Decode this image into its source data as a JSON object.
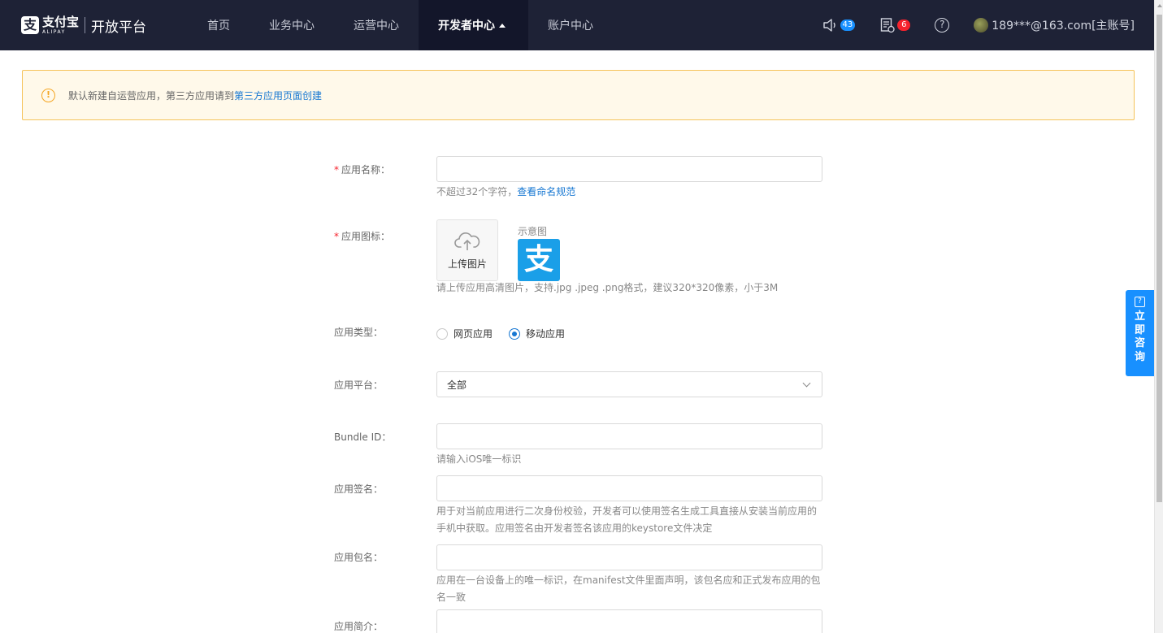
{
  "nav": {
    "brand_cn": "支付宝",
    "brand_en": "ALIPAY",
    "brand_sub": "开放平台",
    "items": [
      {
        "label": "首页"
      },
      {
        "label": "业务中心"
      },
      {
        "label": "运营中心"
      },
      {
        "label": "开发者中心",
        "active": true
      },
      {
        "label": "账户中心"
      }
    ],
    "notifications_count": "43",
    "tasks_count": "6",
    "help_glyph": "?",
    "account": "189***@163.com[主账号]",
    "icons": {
      "speaker": "speaker-icon",
      "task": "task-list-icon",
      "help": "help-icon"
    }
  },
  "alert": {
    "text": "默认新建自运营应用，第三方应用请到",
    "link": "第三方应用页面创建",
    "icon_glyph": "!"
  },
  "form": {
    "app_name": {
      "label": "应用名称：",
      "required": true,
      "value": "",
      "hint_text": "不超过32个字符，",
      "hint_link": "查看命名规范"
    },
    "app_icon": {
      "label": "应用图标：",
      "required": true,
      "upload_label": "上传图片",
      "example_label": "示意图",
      "example_glyph": "支",
      "hint": "请上传应用高清图片，支持.jpg .jpeg .png格式，建议320*320像素，小于3M"
    },
    "app_type": {
      "label": "应用类型：",
      "options": [
        {
          "label": "网页应用",
          "checked": false
        },
        {
          "label": "移动应用",
          "checked": true
        }
      ]
    },
    "platform": {
      "label": "应用平台：",
      "selected": "全部"
    },
    "bundle_id": {
      "label": "Bundle ID：",
      "value": "",
      "hint": "请输入iOS唯一标识"
    },
    "signature": {
      "label": "应用签名：",
      "value": "",
      "hint_line1": "用于对当前应用进行二次身份校验，开发者可以使用签名生成工具直接从安装当前应用的",
      "hint_line2": "手机中获取。应用签名由开发者签名该应用的keystore文件决定"
    },
    "package_name": {
      "label": "应用包名：",
      "value": "",
      "hint_line1": "应用在一台设备上的唯一标识，在manifest文件里面声明，该包名应和正式发布应用的包",
      "hint_line2": "名一致"
    },
    "intro": {
      "label": "应用简介：",
      "value": ""
    }
  },
  "consult": {
    "label": "立即咨询",
    "icon_glyph": "?"
  },
  "colors": {
    "nav_bg": "#1e2236",
    "accent": "#1890ff",
    "link": "#1677d2",
    "alert_bg": "#fff9ea",
    "alert_border": "#f5c35a",
    "required": "#f5222d"
  }
}
